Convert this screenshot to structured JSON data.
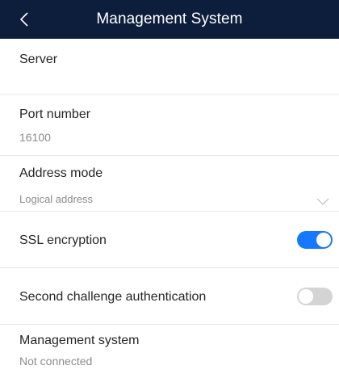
{
  "header": {
    "title": "Management System",
    "back_icon": "chevron-left-icon"
  },
  "server": {
    "label": "Server",
    "value": ""
  },
  "port": {
    "label": "Port number",
    "value": "16100"
  },
  "address_mode": {
    "label": "Address mode",
    "value": "Logical address",
    "icon": "chevron-down-icon"
  },
  "ssl": {
    "label": "SSL encryption",
    "enabled": true
  },
  "second_auth": {
    "label": "Second challenge authentication",
    "enabled": false
  },
  "management_system": {
    "label": "Management system",
    "value": "Not connected"
  },
  "colors": {
    "header_bg": "#0d1e3d",
    "toggle_on": "#1677ff",
    "toggle_off": "#d4d4d4"
  }
}
